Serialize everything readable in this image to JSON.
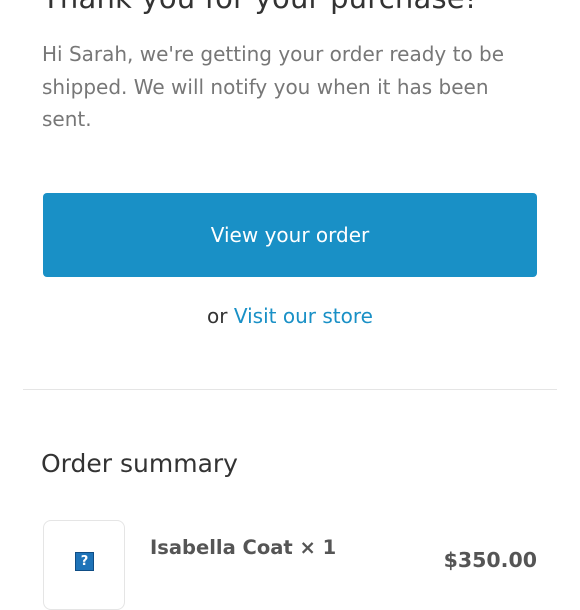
{
  "header": {
    "title": "Thank you for your purchase!"
  },
  "message": {
    "body": "Hi Sarah, we're getting your order ready to be shipped. We will notify you when it has been sent."
  },
  "actions": {
    "view_order_label": "View your order",
    "or_text": "or",
    "visit_store_label": "Visit our store"
  },
  "order_summary": {
    "title": "Order summary",
    "items": [
      {
        "name": "Isabella Coat",
        "quantity_text": "× 1",
        "price": "$350.00",
        "image_icon": "broken-image-icon"
      }
    ]
  },
  "colors": {
    "accent": "#1990c6",
    "text": "#333333",
    "muted_text": "#777777",
    "divider": "#e5e5e5"
  }
}
